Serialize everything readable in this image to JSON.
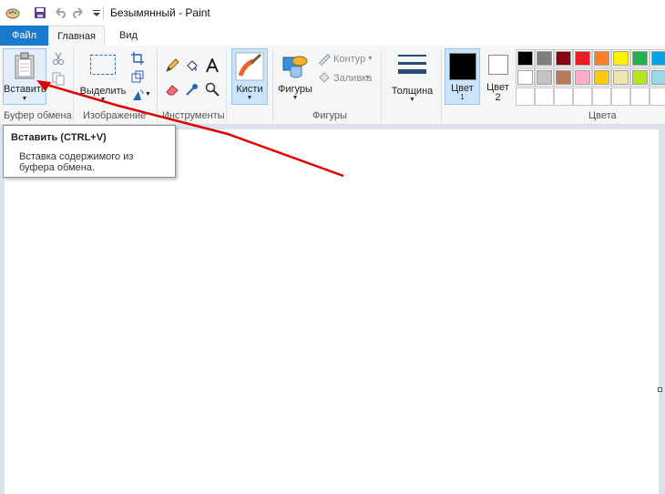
{
  "window": {
    "title": "Безымянный - Paint"
  },
  "tabs": {
    "file": "Файл",
    "home": "Главная",
    "view": "Вид"
  },
  "groups": {
    "clipboard": "Буфер обмена",
    "image": "Изображение",
    "tools": "Инструменты",
    "shapes": "Фигуры",
    "colors": "Цвета"
  },
  "buttons": {
    "paste": "Вставить",
    "select": "Выделить",
    "brushes": "Кисти",
    "shapes": "Фигуры",
    "outline": "Контур",
    "fill": "Заливка",
    "size": "Толщина",
    "color1": "Цвет",
    "color2": "Цвет",
    "color2_num": "2"
  },
  "colors": {
    "accent": "#1979ca",
    "color1": "#000000",
    "color2": "#ffffff",
    "palette_row1": [
      "#000000",
      "#7f7f7f",
      "#880015",
      "#ed1c24",
      "#ff7f27",
      "#fff200",
      "#22b14c",
      "#00a2e8"
    ],
    "palette_row2": [
      "#ffffff",
      "#c3c3c3",
      "#b97a57",
      "#ffaec9",
      "#ffc90e",
      "#efe4b0",
      "#b5e61d",
      "#99d9ea"
    ],
    "annotation_arrow": "#e00000"
  },
  "tooltip": {
    "title": "Вставить (CTRL+V)",
    "body": "Вставка содержимого из буфера обмена."
  }
}
